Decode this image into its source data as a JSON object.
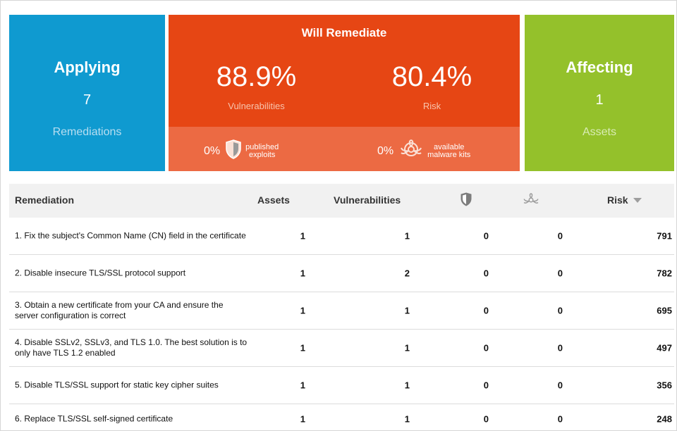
{
  "applying": {
    "title": "Applying",
    "count": "7",
    "label": "Remediations"
  },
  "will_remediate": {
    "title": "Will Remediate",
    "vulnerabilities_pct": "88.9%",
    "vulnerabilities_label": "Vulnerabilities",
    "risk_pct": "80.4%",
    "risk_label": "Risk",
    "exploits_pct": "0%",
    "exploits_label_line1": "published",
    "exploits_label_line2": "exploits",
    "malware_pct": "0%",
    "malware_label_line1": "available",
    "malware_label_line2": "malware kits"
  },
  "affecting": {
    "title": "Affecting",
    "count": "1",
    "label": "Assets"
  },
  "table": {
    "headers": {
      "remediation": "Remediation",
      "assets": "Assets",
      "vulnerabilities": "Vulnerabilities",
      "risk": "Risk"
    },
    "header_icons": {
      "exploits": "shield-icon",
      "malware": "biohazard-icon",
      "sort": "sort-descending-icon"
    },
    "rows": [
      {
        "remediation": "1. Fix the subject's Common Name (CN) field in the certificate",
        "assets": "1",
        "vulnerabilities": "1",
        "exploits": "0",
        "malware": "0",
        "risk": "791"
      },
      {
        "remediation": "2. Disable insecure TLS/SSL protocol support",
        "assets": "1",
        "vulnerabilities": "2",
        "exploits": "0",
        "malware": "0",
        "risk": "782"
      },
      {
        "remediation": "3. Obtain a new certificate from your CA and ensure the server configuration is correct",
        "assets": "1",
        "vulnerabilities": "1",
        "exploits": "0",
        "malware": "0",
        "risk": "695"
      },
      {
        "remediation": "4. Disable SSLv2, SSLv3, and TLS 1.0. The best solution is to only have TLS 1.2 enabled",
        "assets": "1",
        "vulnerabilities": "1",
        "exploits": "0",
        "malware": "0",
        "risk": "497"
      },
      {
        "remediation": "5. Disable TLS/SSL support for static key cipher suites",
        "assets": "1",
        "vulnerabilities": "1",
        "exploits": "0",
        "malware": "0",
        "risk": "356"
      },
      {
        "remediation": "6. Replace TLS/SSL self-signed certificate",
        "assets": "1",
        "vulnerabilities": "1",
        "exploits": "0",
        "malware": "0",
        "risk": "248"
      }
    ]
  },
  "colors": {
    "applying": "#0f9ad0",
    "will_remediate": "#e64614",
    "will_remediate_footer": "#ec6a43",
    "affecting": "#94c12b",
    "header_bg": "#f1f1f1"
  }
}
